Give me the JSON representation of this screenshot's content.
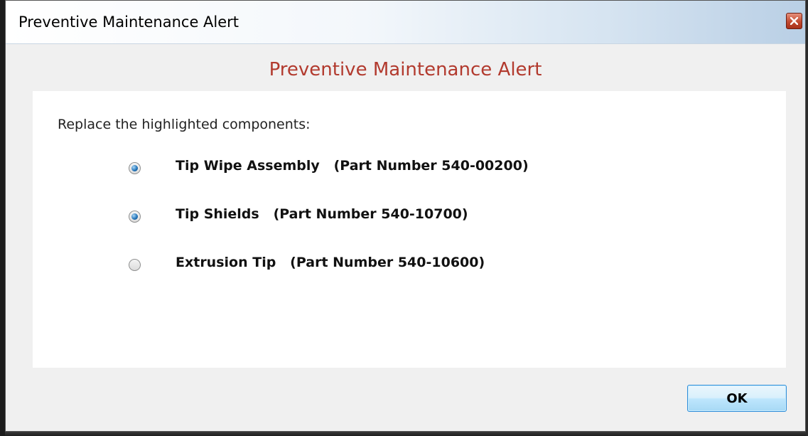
{
  "window": {
    "title": "Preventive Maintenance Alert",
    "close_icon": "close-icon"
  },
  "dialog": {
    "heading": "Preventive Maintenance Alert",
    "instruction": "Replace the highlighted components:",
    "items": [
      {
        "label": "Tip Wipe Assembly   (Part Number 540-00200)",
        "checked": true
      },
      {
        "label": "Tip Shields   (Part Number 540-10700)",
        "checked": true
      },
      {
        "label": "Extrusion Tip   (Part Number 540-10600)",
        "checked": false
      }
    ],
    "ok_label": "OK"
  },
  "colors": {
    "heading": "#b23a2e",
    "panel_background": "#ffffff",
    "dialog_background": "#f0f0f0",
    "ok_button_border": "#2f8dd8"
  }
}
